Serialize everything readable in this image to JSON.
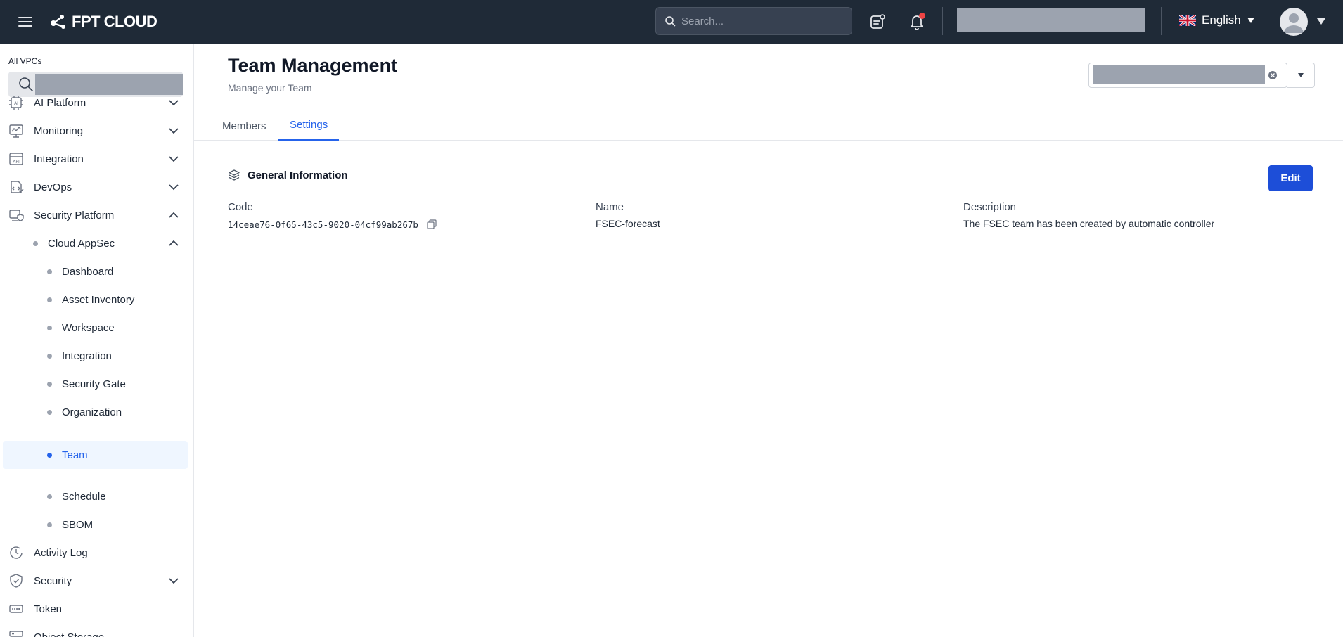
{
  "topbar": {
    "brand": "FPT CLOUD",
    "search_placeholder": "Search...",
    "language": "English"
  },
  "sidebar": {
    "vpc_label": "All VPCs",
    "items": [
      {
        "label": "AI Platform",
        "icon": "ai-chip-icon",
        "expanded": false
      },
      {
        "label": "Monitoring",
        "icon": "monitor-icon",
        "expanded": false
      },
      {
        "label": "Integration",
        "icon": "api-icon",
        "expanded": false
      },
      {
        "label": "DevOps",
        "icon": "devops-icon",
        "expanded": false
      },
      {
        "label": "Security Platform",
        "icon": "security-platform-icon",
        "expanded": true
      },
      {
        "label": "Cloud AppSec",
        "expanded": true
      },
      {
        "label": "Dashboard"
      },
      {
        "label": "Asset Inventory"
      },
      {
        "label": "Workspace"
      },
      {
        "label": "Integration"
      },
      {
        "label": "Security Gate"
      },
      {
        "label": "Organization"
      },
      {
        "label": "Team",
        "active": true
      },
      {
        "label": "Schedule"
      },
      {
        "label": "SBOM"
      },
      {
        "label": "Activity Log",
        "icon": "clock-icon"
      },
      {
        "label": "Security",
        "icon": "shield-icon",
        "expanded": false
      },
      {
        "label": "Token",
        "icon": "token-icon"
      },
      {
        "label": "Object Storage",
        "icon": "storage-icon"
      }
    ]
  },
  "main": {
    "title": "Team Management",
    "subtitle": "Manage your Team",
    "tabs": [
      {
        "label": "Members",
        "active": false
      },
      {
        "label": "Settings",
        "active": true
      }
    ],
    "section_title": "General Information",
    "edit_label": "Edit",
    "fields": {
      "code_label": "Code",
      "code_value": "14ceae76-0f65-43c5-9020-04cf99ab267b",
      "name_label": "Name",
      "name_value": "FSEC-forecast",
      "description_label": "Description",
      "description_value": "The FSEC team has been created by automatic controller"
    }
  },
  "colors": {
    "topbar_bg": "#1f2a37",
    "accent": "#2563eb",
    "button": "#1d4ed8",
    "notification": "#ef4444"
  }
}
